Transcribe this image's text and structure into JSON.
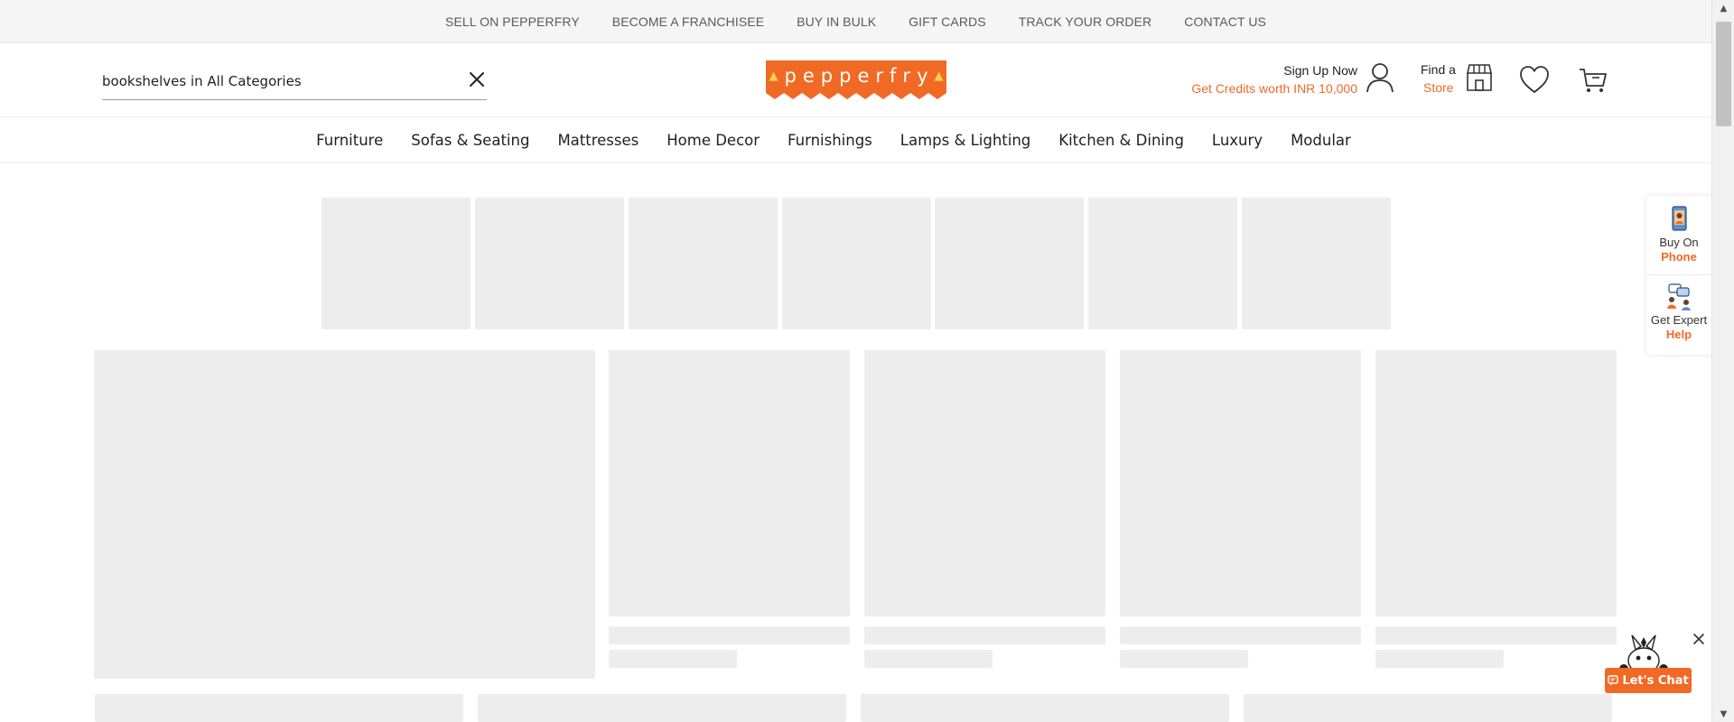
{
  "utility_bar": {
    "links": [
      {
        "label": "SELL ON PEPPERFRY"
      },
      {
        "label": "BECOME A FRANCHISEE"
      },
      {
        "label": "BUY IN BULK"
      },
      {
        "label": "GIFT CARDS"
      },
      {
        "label": "TRACK YOUR ORDER"
      },
      {
        "label": "CONTACT US"
      }
    ]
  },
  "header": {
    "search": {
      "value": "bookshelves in All Categories",
      "placeholder": "",
      "clear_icon": "close-icon"
    },
    "logo": {
      "letters": [
        "p",
        "e",
        "p",
        "p",
        "e",
        "r",
        "f",
        "r",
        "y"
      ],
      "brand_color": "#f06a25"
    },
    "account": {
      "title": "Sign Up Now",
      "subtitle": "Get Credits worth INR 10,000",
      "icon": "user-icon"
    },
    "store": {
      "title": "Find a",
      "subtitle": "Store",
      "icon": "store-icon"
    },
    "wishlist_icon": "heart-icon",
    "cart_icon": "cart-icon"
  },
  "category_nav": {
    "items": [
      {
        "label": "Furniture"
      },
      {
        "label": "Sofas & Seating"
      },
      {
        "label": "Mattresses"
      },
      {
        "label": "Home Decor"
      },
      {
        "label": "Furnishings"
      },
      {
        "label": "Lamps & Lighting"
      },
      {
        "label": "Kitchen & Dining"
      },
      {
        "label": "Luxury"
      },
      {
        "label": "Modular"
      }
    ]
  },
  "float_panel": {
    "phone": {
      "label": "Buy On",
      "accent": "Phone",
      "icon": "phone-icon"
    },
    "expert": {
      "label": "Get Expert",
      "accent": "Help",
      "icon": "expert-help-icon"
    }
  },
  "chat": {
    "label": "Let's Chat",
    "icon": "chat-icon",
    "close_icon": "close-icon",
    "mascot_icon": "mascot-icon"
  },
  "colors": {
    "accent": "#f06a25",
    "skeleton": "#ededed",
    "utility_bg": "#f5f5f5"
  }
}
